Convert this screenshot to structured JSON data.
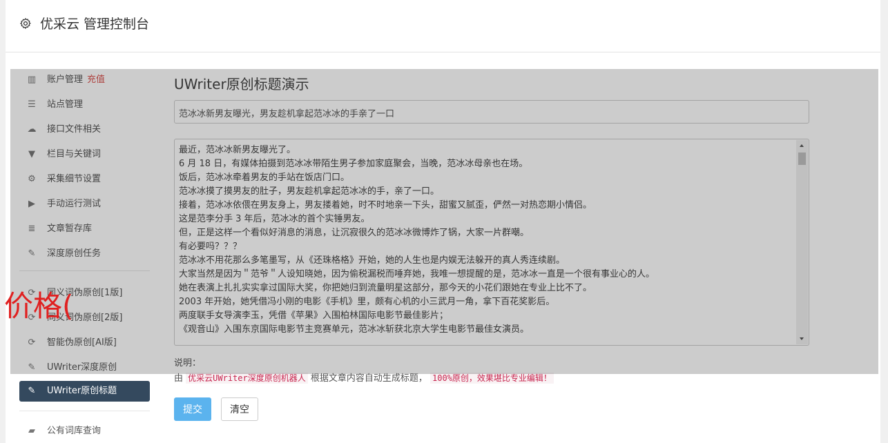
{
  "header": {
    "title": "优采云 管理控制台",
    "icon": "gear-icon"
  },
  "sidebar": {
    "items": [
      {
        "label": "账户管理",
        "extra": "充值",
        "icon": "bar-chart-icon"
      },
      {
        "label": "站点管理",
        "icon": "server-icon"
      },
      {
        "label": "接口文件相关",
        "icon": "cloud-upload-icon"
      },
      {
        "label": "栏目与关键词",
        "icon": "filter-icon"
      },
      {
        "label": "采集细节设置",
        "icon": "cogs-icon"
      },
      {
        "label": "手动运行测试",
        "icon": "play-circle-icon"
      },
      {
        "label": "文章暂存库",
        "icon": "database-icon"
      },
      {
        "label": "深度原创任务",
        "icon": "edit-icon"
      },
      {
        "label": "同义词伪原创[1版]",
        "icon": "refresh-icon"
      },
      {
        "label": "同义词伪原创[2版]",
        "icon": "refresh-icon"
      },
      {
        "label": "智能伪原创[AI版]",
        "icon": "refresh-icon"
      },
      {
        "label": "UWriter深度原创",
        "icon": "edit-icon"
      },
      {
        "label": "UWriter原创标题",
        "icon": "edit-icon",
        "active": true
      },
      {
        "label": "公有词库查询",
        "icon": "book-icon"
      }
    ]
  },
  "content": {
    "title": "UWriter原创标题演示",
    "title_input": "范冰冰新男友曝光，男友趁机拿起范冰冰的手亲了一口",
    "article_lines": [
      "最近，范冰冰新男友曝光了。",
      "6 月 18 日，有媒体拍摄到范冰冰带陌生男子参加家庭聚会，当晚，范冰冰母亲也在场。",
      "饭后，范冰冰牵着男友的手站在饭店门口。",
      "范冰冰摸了摸男友的肚子，男友趁机拿起范冰冰的手，亲了一口。",
      "接着，范冰冰依偎在男友身上，男友搂着她，时不时地亲一下头，甜蜜又腻歪，俨然一对热恋期小情侣。",
      "这是范李分手 3 年后，范冰冰的首个实锤男友。",
      "但，正是这样一个看似好消息的消息，让沉寂很久的范冰冰微博炸了锅，大家一片群嘲。",
      "有必要吗？？？",
      "范冰冰不用花那么多笔墨写，从《还珠格格》开始，她的人生也是内娱无法躲开的真人秀连续剧。",
      "大家当然是因为＂范爷＂人设知晓她，因为偷税漏税而唾弃她，我唯一想提醒的是，范冰冰一直是一个很有事业心的人。",
      "她在表演上扎扎实实拿过国际大奖，你把她归到流量明星这部分，那今天的小花们跟她在专业上比不了。",
      "2003 年开始，她凭借冯小刚的电影《手机》里，颇有心机的小三武月一角，拿下百花奖影后。",
      "两度联手女导演李玉，凭借《苹果》入围柏林国际电影节最佳影片；",
      "《观音山》入围东京国际电影节主竞赛单元，范冰冰斩获北京大学生电影节最佳女演员。"
    ],
    "note_label": "说明：",
    "note_prefix": "由",
    "note_code1": "优采云UWriter深度原创机器人",
    "note_middle": "根据文章内容自动生成标题，",
    "note_code2": "100%原创，效果堪比专业编辑！",
    "submit_label": "提交",
    "clear_label": "清空"
  },
  "overlay_text": "价格(",
  "colors": {
    "active_nav": "#34495e",
    "submit": "#5bb3ee",
    "recharge": "#d9534f",
    "overlay_text": "#e02020"
  }
}
